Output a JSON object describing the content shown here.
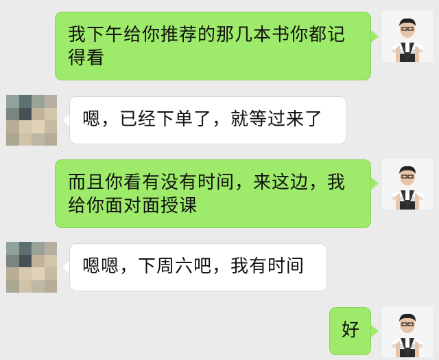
{
  "messages": [
    {
      "side": "sent",
      "text": "我下午给你推荐的那几本书你都记得看"
    },
    {
      "side": "received",
      "text": "嗯，已经下单了，就等过来了"
    },
    {
      "side": "sent",
      "text": "而且你看有没有时间，来这边，我给你面对面授课"
    },
    {
      "side": "received",
      "text": "嗯嗯，下周六吧，我有时间"
    },
    {
      "side": "sent",
      "text": "好"
    }
  ],
  "colors": {
    "background": "#ebebeb",
    "sent_bubble": "#9eea6a",
    "received_bubble": "#ffffff"
  },
  "icons": {
    "me_avatar": "man-in-vest-avatar",
    "other_avatar": "pixelated-avatar"
  }
}
